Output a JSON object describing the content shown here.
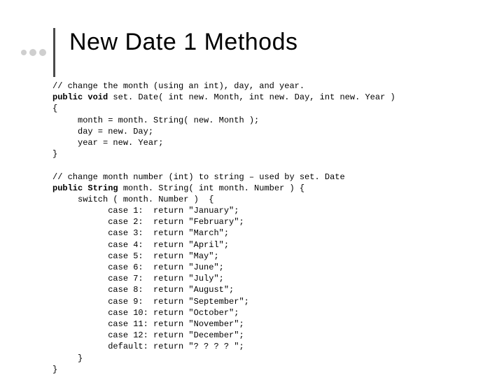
{
  "title": "New Date 1 Methods",
  "code": {
    "l01": "// change the month (using an int), day, and year.",
    "l02a": "public void",
    "l02b": " set. Date( int new. Month, int new. Day, int new. Year )",
    "l03": "{",
    "l04": "     month = month. String( new. Month );",
    "l05": "     day = new. Day;",
    "l06": "     year = new. Year;",
    "l07": "}",
    "l08": "",
    "l09": "// change month number (int) to string – used by set. Date",
    "l10a": "public String",
    "l10b": " month. String( int month. Number ) {",
    "l11": "     switch ( month. Number )  {",
    "l12": "           case 1:  return \"January\";",
    "l13": "           case 2:  return \"February\";",
    "l14": "           case 3:  return \"March\";",
    "l15": "           case 4:  return \"April\";",
    "l16": "           case 5:  return \"May\";",
    "l17": "           case 6:  return \"June\";",
    "l18": "           case 7:  return \"July\";",
    "l19": "           case 8:  return \"August\";",
    "l20": "           case 9:  return \"September\";",
    "l21": "           case 10: return \"October\";",
    "l22": "           case 11: return \"November\";",
    "l23": "           case 12: return \"December\";",
    "l24": "           default: return \"? ? ? ? \";",
    "l25": "     }",
    "l26": "}"
  }
}
